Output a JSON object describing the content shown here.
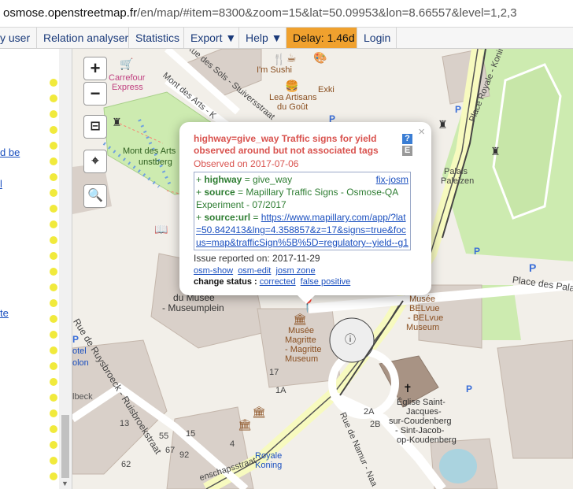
{
  "browser": {
    "url_host": "osmose.openstreetmap.fr",
    "url_rest": "/en/map/#item=8300&zoom=15&lat=50.09953&lon=8.66557&level=1,2,3"
  },
  "menu": {
    "items": [
      "y user",
      "Relation analyser",
      "Statistics",
      "Export ▼",
      "Help ▼",
      "Delay: 1.46d",
      "Login"
    ]
  },
  "sidebar": {
    "links": [
      "d be",
      "l",
      "te"
    ]
  },
  "map_controls": {
    "zoom_in": "+",
    "zoom_out": "−",
    "layers": "⊟",
    "locate": "⌖",
    "search": "🔍"
  },
  "map_labels": {
    "street_sols": "Rue des Sols - Stuiversstraat",
    "mont_arts": "Mont des Arts - K",
    "mont_des_arts_park": "Mont des Arts",
    "kunstberg": "unstberg",
    "carrefour": "Carrefour",
    "express": "Express",
    "im_sushi": "I'm Sushi",
    "lea_artisans": "Lea Artisans",
    "du_gout": "du Goût",
    "exki": "Exki",
    "place_royale": "Place Royale - Koningsp",
    "palais": "Palais",
    "paleizen": "Paleizen",
    "place_palais": "Place des Palais",
    "du_musee": "du Musée",
    "museumplein": "- Museumplein",
    "musee_magritte_1": "Musée",
    "musee_magritte_2": "Magritte",
    "musee_magritte_3": "- Magritte",
    "musee_magritte_4": "Museum",
    "musee_bellevue_1": "Musée",
    "musee_bellevue_2": "BELvue",
    "musee_bellevue_3": "- BELvue",
    "musee_bellevue_4": "Museum",
    "ruysbroeck": "Rue de Ruysbroeck - Ruisbroekstraat",
    "hotel": "otel",
    "colon": "olon",
    "lbeck": "lbeck",
    "royale_1": "Royale",
    "royale_2": "Koning",
    "rue_namur": "Rue de Namur - Naa",
    "eglise_1": "Église Saint-",
    "eglise_2": "Jacques-",
    "eglise_3": "sur-Coudenberg",
    "eglise_4": "- Sint-Jacob-",
    "eglise_5": "op-Koudenberg",
    "wetenschap": "enschapsstraat",
    "num_17": "17",
    "num_1a": "1A",
    "num_2a": "2A",
    "num_2b": "2B",
    "num_13": "13",
    "num_55": "55",
    "num_67": "67",
    "num_92": "92",
    "num_62": "62",
    "num_15": "15",
    "num_4": "4"
  },
  "popup": {
    "title": "highway=give_way Traffic signs for yield observed around but not associated tags",
    "observed": "Observed on 2017-07-06",
    "help_badge": "?",
    "e_badge": "E",
    "fix_link": "fix-josm",
    "tags": [
      {
        "prefix": "+ ",
        "key": "highway",
        "sep": " = ",
        "value": "give_way"
      },
      {
        "prefix": "+ ",
        "key": "source",
        "sep": " = ",
        "value": "Mapillary Traffic Signs - Osmose-QA Experiment - 07/2017"
      },
      {
        "prefix": "+ ",
        "key": "source:url",
        "sep": " = ",
        "value": "https://www.mapillary.com/app/?lat=50.842413&lng=4.358857&z=17&signs=true&focus=map&trafficSign%5B%5D=regulatory--yield--g1"
      }
    ],
    "reported": "Issue reported on: 2017-11-29",
    "actions": [
      "osm-show",
      "osm-edit",
      "josm zone"
    ],
    "status_label": "change status :",
    "status_actions": [
      "corrected",
      "false positive"
    ],
    "close": "×"
  },
  "colors": {
    "delay_bg": "#f0a12e",
    "link": "#1a4fbf",
    "error_title": "#d9534f",
    "tag_green": "#2e7d32",
    "marker_yellow": "#f1ea3c"
  }
}
